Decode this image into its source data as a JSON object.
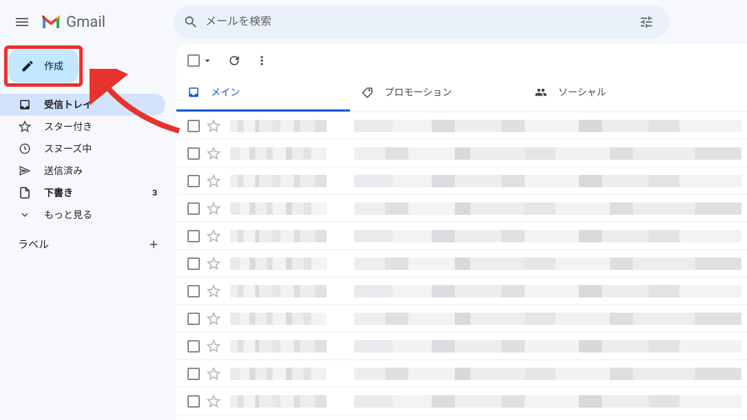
{
  "header": {
    "app_name": "Gmail",
    "search_placeholder": "メールを検索"
  },
  "sidebar": {
    "compose_label": "作成",
    "items": [
      {
        "label": "受信トレイ",
        "icon": "inbox",
        "active": true,
        "bold": true,
        "count": ""
      },
      {
        "label": "スター付き",
        "icon": "star",
        "active": false,
        "bold": false,
        "count": ""
      },
      {
        "label": "スヌーズ中",
        "icon": "clock",
        "active": false,
        "bold": false,
        "count": ""
      },
      {
        "label": "送信済み",
        "icon": "send",
        "active": false,
        "bold": false,
        "count": ""
      },
      {
        "label": "下書き",
        "icon": "file",
        "active": false,
        "bold": true,
        "count": "3"
      },
      {
        "label": "もっと見る",
        "icon": "expand",
        "active": false,
        "bold": false,
        "count": ""
      }
    ],
    "labels_label": "ラベル"
  },
  "main": {
    "tabs": [
      {
        "label": "メイン",
        "icon": "inbox-tab",
        "active": true
      },
      {
        "label": "プロモーション",
        "icon": "tag",
        "active": false
      },
      {
        "label": "ソーシャル",
        "icon": "people",
        "active": false
      }
    ],
    "row_count": 11
  }
}
